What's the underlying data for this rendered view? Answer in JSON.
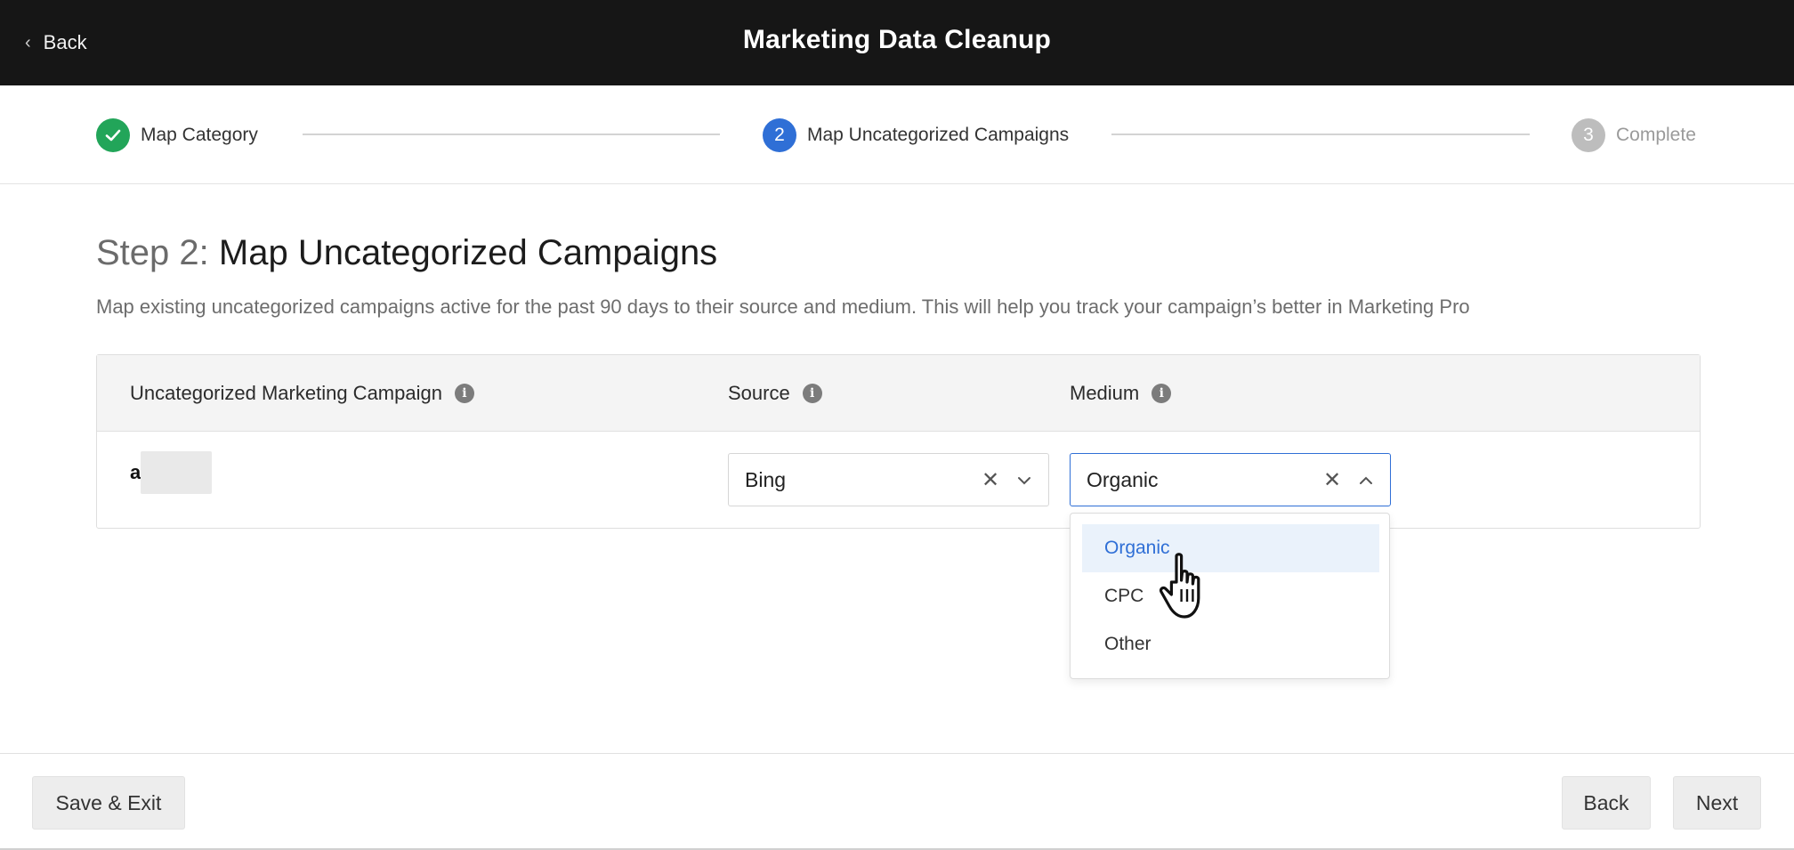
{
  "header": {
    "back_label": "Back",
    "title": "Marketing Data Cleanup"
  },
  "stepper": {
    "steps": [
      {
        "number": "1",
        "label": "Map Category",
        "state": "completed"
      },
      {
        "number": "2",
        "label": "Map Uncategorized Campaigns",
        "state": "active"
      },
      {
        "number": "3",
        "label": "Complete",
        "state": "upcoming"
      }
    ]
  },
  "main": {
    "heading_prefix": "Step 2:",
    "heading_title": "Map Uncategorized Campaigns",
    "description": "Map existing uncategorized campaigns active for the past 90 days to their source and medium. This will help you track your campaign’s better in Marketing Pro"
  },
  "table": {
    "columns": [
      {
        "label": "Uncategorized Marketing Campaign",
        "icon": "info-icon"
      },
      {
        "label": "Source",
        "icon": "info-icon"
      },
      {
        "label": "Medium",
        "icon": "info-icon"
      }
    ],
    "rows": [
      {
        "campaign": "a",
        "source": "Bing",
        "medium": "Organic"
      }
    ]
  },
  "medium_dropdown": {
    "options": [
      "Organic",
      "CPC",
      "Other"
    ],
    "highlighted": "Organic"
  },
  "footer": {
    "save_exit_label": "Save & Exit",
    "back_label": "Back",
    "next_label": "Next"
  },
  "colors": {
    "header_bg": "#161616",
    "step_complete": "#22a559",
    "step_active": "#2f6fd6",
    "step_upcoming": "#bdbdbd",
    "accent": "#2f6fd6"
  }
}
